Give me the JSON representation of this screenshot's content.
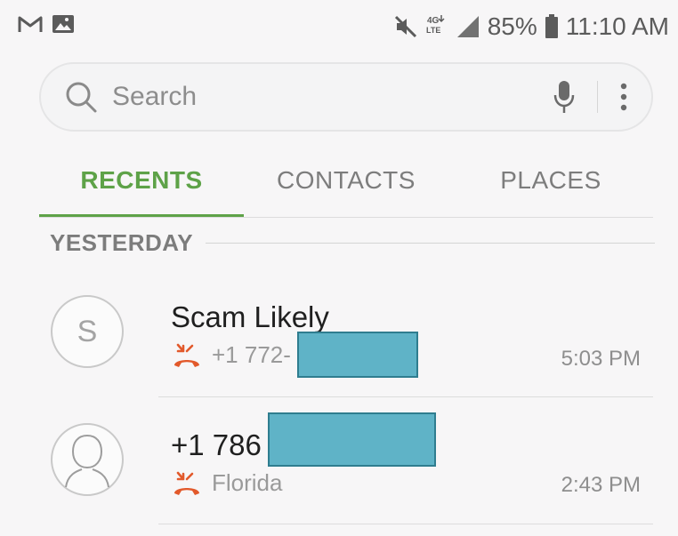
{
  "status_bar": {
    "left_icons": [
      "gmail-icon",
      "gallery-icon"
    ],
    "right_icons": [
      "mute-icon",
      "4g-lte-icon",
      "signal-icon"
    ],
    "battery_percent": "85%",
    "time": "11:10 AM"
  },
  "search": {
    "placeholder": "Search"
  },
  "tabs": [
    {
      "label": "RECENTS",
      "active": true
    },
    {
      "label": "CONTACTS",
      "active": false
    },
    {
      "label": "PLACES",
      "active": false
    }
  ],
  "section": {
    "label": "YESTERDAY"
  },
  "calls": [
    {
      "avatar_letter": "S",
      "name": "Scam Likely",
      "number_visible": "+1 772-",
      "location": "",
      "time": "5:03 PM",
      "call_icon": "missed-call-icon",
      "redacted": true
    },
    {
      "avatar_letter": "",
      "name": "+1 786",
      "number_visible": "",
      "location": "Florida",
      "time": "2:43 PM",
      "call_icon": "missed-call-icon",
      "redacted": true
    }
  ],
  "colors": {
    "accent_green": "#5ea248",
    "missed_call": "#e2592b",
    "redaction": "#5fb3c7"
  }
}
